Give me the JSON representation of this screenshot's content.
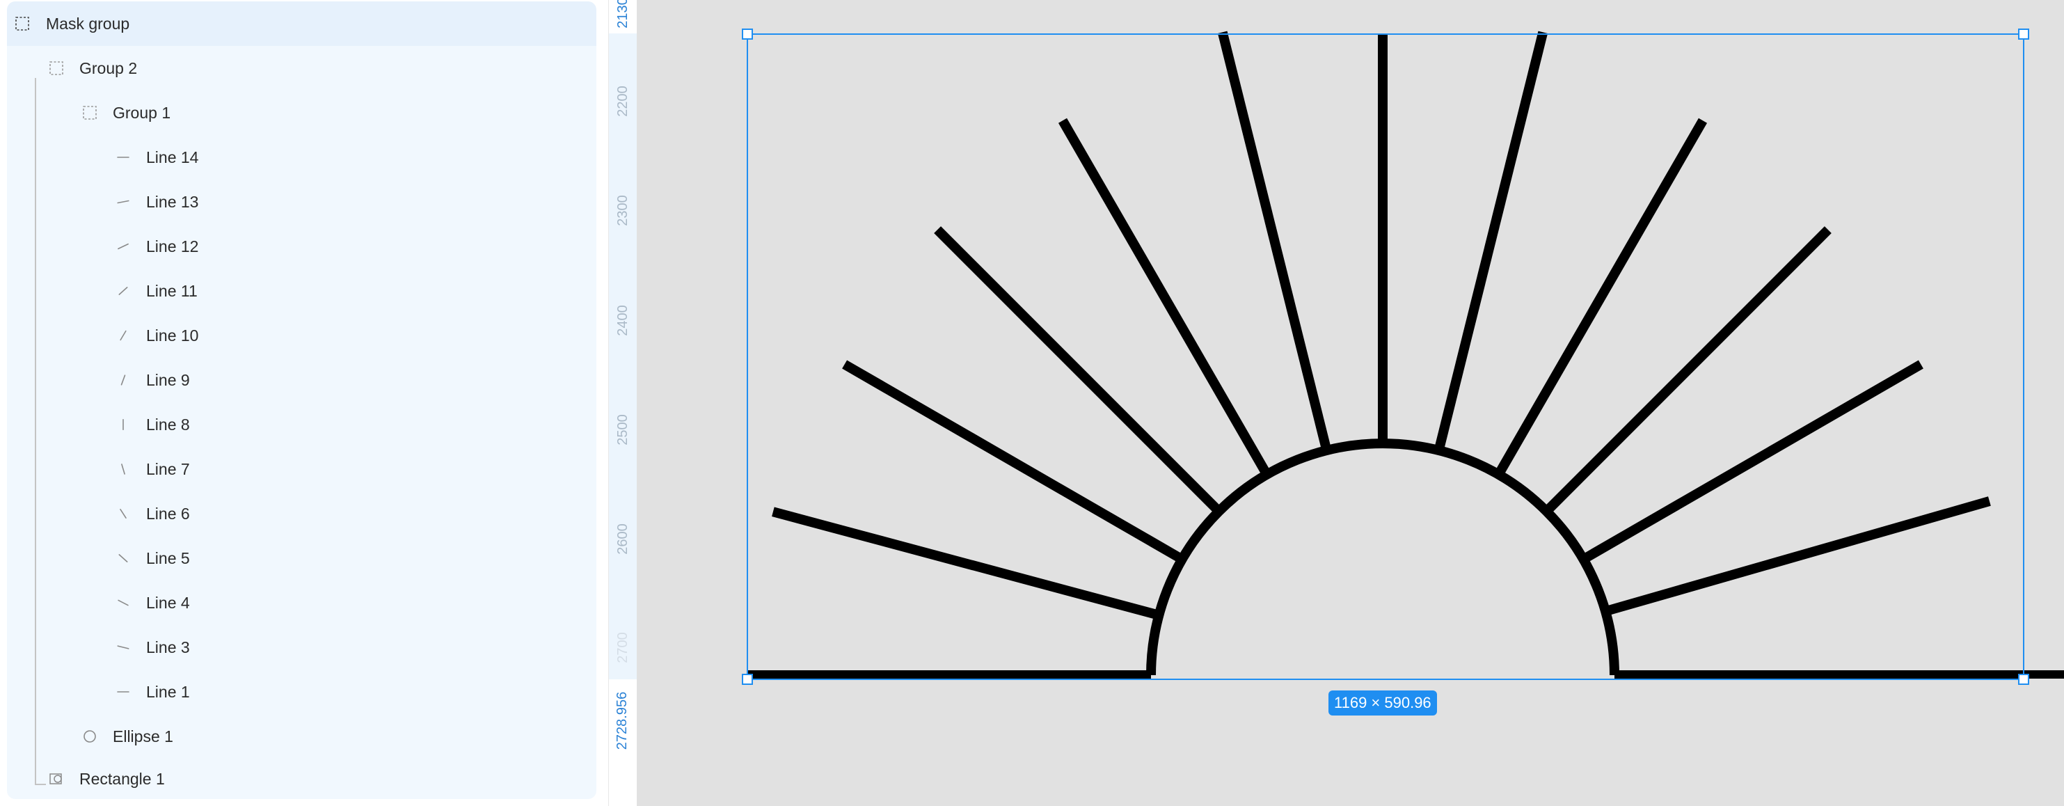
{
  "layers": [
    {
      "name": "Mask group",
      "icon": "frame-dashed-icon"
    },
    {
      "name": "Group 2",
      "icon": "group-dashed-icon"
    },
    {
      "name": "Group 1",
      "icon": "group-dashed-icon"
    },
    {
      "name": "Line 14",
      "icon": "line-icon"
    },
    {
      "name": "Line 13",
      "icon": "line-icon"
    },
    {
      "name": "Line 12",
      "icon": "line-icon"
    },
    {
      "name": "Line 11",
      "icon": "line-icon"
    },
    {
      "name": "Line 10",
      "icon": "line-icon"
    },
    {
      "name": "Line 9",
      "icon": "line-icon"
    },
    {
      "name": "Line 8",
      "icon": "line-icon"
    },
    {
      "name": "Line 7",
      "icon": "line-icon"
    },
    {
      "name": "Line 6",
      "icon": "line-icon"
    },
    {
      "name": "Line 5",
      "icon": "line-icon"
    },
    {
      "name": "Line 4",
      "icon": "line-icon"
    },
    {
      "name": "Line 3",
      "icon": "line-icon"
    },
    {
      "name": "Line 1",
      "icon": "line-icon"
    },
    {
      "name": "Ellipse 1",
      "icon": "ellipse-icon"
    },
    {
      "name": "Rectangle 1",
      "icon": "mask-rectangle-icon"
    }
  ],
  "ruler": {
    "top_value": "2130",
    "ticks": [
      "2200",
      "2300",
      "2400",
      "2500",
      "2600",
      "2700"
    ],
    "bottom_value": "2728.956"
  },
  "selection": {
    "dimensions": "1169 × 590.96"
  },
  "colors": {
    "accent": "#1f8ef1",
    "panel_selection": "#f1f8fe",
    "canvas": "#e1e1e1",
    "artwork": "#000000"
  }
}
